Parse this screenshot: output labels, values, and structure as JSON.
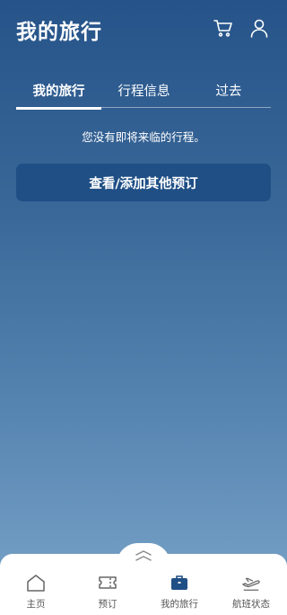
{
  "header": {
    "title": "我的旅行",
    "icons": [
      "cart-icon",
      "user-icon"
    ]
  },
  "tabs": [
    {
      "label": "我的旅行",
      "active": true
    },
    {
      "label": "行程信息",
      "active": false
    },
    {
      "label": "过去",
      "active": false
    }
  ],
  "main": {
    "empty_message": "您没有即将来临的行程。",
    "cta_label": "查看/添加其他预订"
  },
  "bottom_nav": {
    "items": [
      {
        "label": "主页",
        "icon": "home-icon"
      },
      {
        "label": "预订",
        "icon": "ticket-icon"
      },
      {
        "label": "我的旅行",
        "icon": "briefcase-icon",
        "active": true
      },
      {
        "label": "航班状态",
        "icon": "airplane-icon"
      }
    ]
  },
  "colors": {
    "accent_dark": "#1f4f85",
    "active_nav_icon": "#1f4f85",
    "bg_top": "#26548a",
    "bg_bottom": "#7aa4c8"
  }
}
